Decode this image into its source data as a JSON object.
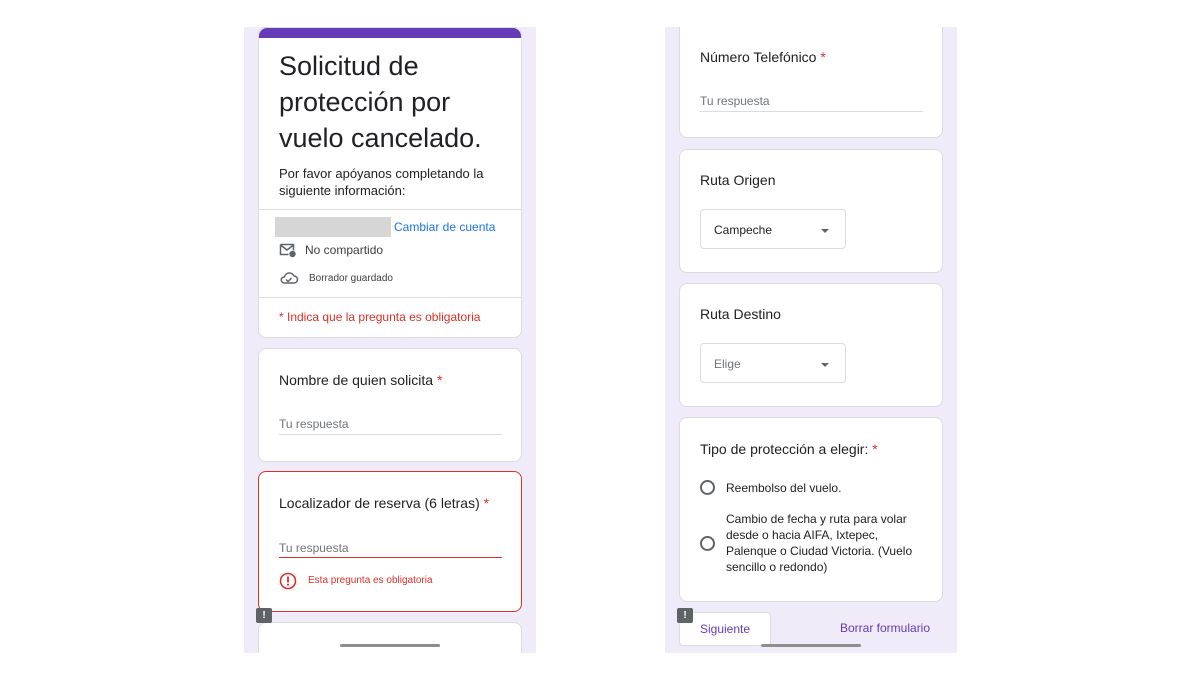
{
  "left": {
    "header": {
      "title": "Solicitud de protección por vuelo cancelado.",
      "description": "Por favor apóyanos completando la siguiente información:",
      "switch_account": "Cambiar de cuenta",
      "not_shared": "No compartido",
      "draft_saved": "Borrador guardado",
      "required_note": "* Indica que la pregunta es obligatoria"
    },
    "q_name": {
      "label": "Nombre de quien solicita",
      "required_mark": "*",
      "placeholder": "Tu respuesta"
    },
    "q_locator": {
      "label": "Localizador de reserva (6 letras)",
      "required_mark": "*",
      "placeholder": "Tu respuesta",
      "error": "Esta pregunta es obligatoria"
    }
  },
  "right": {
    "q_phone": {
      "label": "Número Telefónico",
      "required_mark": "*",
      "placeholder": "Tu respuesta"
    },
    "q_origin": {
      "label": "Ruta Origen",
      "selected": "Campeche"
    },
    "q_destination": {
      "label": "Ruta Destino",
      "selected": "Elige"
    },
    "q_protection": {
      "label": "Tipo de protección a elegir:",
      "required_mark": "*",
      "options": [
        "Reembolso del vuelo.",
        "Cambio de fecha y ruta para volar desde o hacia AIFA, Ixtepec, Palenque o Ciudad Victoria. (Vuelo sencillo o redondo)"
      ]
    },
    "footer": {
      "next": "Siguiente",
      "clear": "Borrar formulario"
    }
  },
  "colors": {
    "accent": "#673ab7",
    "error": "#d93025",
    "link": "#1a73e8",
    "background": "#f0ebf8"
  },
  "icons": [
    "mail-off-icon",
    "cloud-check-icon",
    "error-icon",
    "feedback-icon",
    "dropdown-arrow-icon"
  ]
}
